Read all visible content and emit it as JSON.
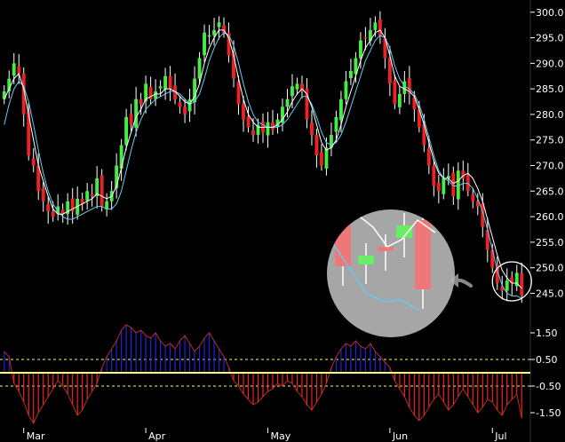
{
  "chart_data": [
    {
      "type": "candlestick",
      "title": "",
      "x_labels": [
        "Mar",
        "Apr",
        "May",
        "Jun",
        "Jul"
      ],
      "y_ticks": [
        "300.0",
        "295.0",
        "290.0",
        "285.0",
        "280.0",
        "275.0",
        "270.0",
        "265.0",
        "260.0",
        "255.0",
        "250.0",
        "245.0"
      ],
      "ylim": [
        243.0,
        301.0
      ],
      "grid": false,
      "colors": {
        "up": "#44ee44",
        "down": "#ee2222",
        "wick": "#ffffff",
        "ma_fast": "#ffffff",
        "ma_slow": "#66ccee"
      },
      "closes": [
        284.5,
        287.0,
        290.0,
        288.0,
        280.0,
        272.0,
        270.0,
        265.0,
        263.0,
        261.0,
        260.0,
        262.0,
        260.5,
        263.0,
        261.0,
        263.5,
        262.5,
        265.0,
        264.0,
        267.5,
        262.0,
        263.0,
        265.0,
        270.0,
        274.0,
        279.5,
        278.0,
        283.0,
        282.0,
        286.0,
        283.0,
        284.5,
        285.5,
        287.5,
        285.0,
        283.0,
        281.5,
        280.0,
        283.0,
        287.0,
        291.0,
        296.0,
        295.5,
        296.5,
        298.0,
        296.0,
        291.5,
        287.0,
        282.0,
        279.0,
        277.5,
        276.0,
        278.0,
        276.5,
        278.5,
        277.0,
        279.0,
        281.5,
        283.0,
        285.5,
        286.0,
        284.5,
        279.0,
        276.0,
        272.0,
        270.0,
        273.5,
        276.0,
        279.5,
        283.0,
        286.5,
        288.5,
        291.0,
        294.5,
        295.0,
        296.5,
        298.0,
        295.5,
        291.0,
        286.0,
        282.0,
        284.0,
        286.5,
        284.0,
        281.0,
        277.5,
        274.0,
        270.0,
        266.0,
        265.0,
        267.5,
        268.0,
        264.0,
        269.0,
        267.5,
        265.0,
        263.0,
        262.0,
        258.0,
        253.5,
        250.0,
        247.0,
        245.5,
        247.5,
        247.0,
        249.0,
        244.5
      ],
      "ma_fast": [
        283.0,
        285.0,
        287.0,
        288.0,
        285.0,
        280.0,
        275.0,
        270.0,
        267.0,
        264.0,
        261.5,
        260.5,
        260.5,
        261.0,
        261.5,
        262.0,
        262.5,
        263.0,
        263.5,
        264.5,
        264.0,
        263.5,
        264.0,
        266.0,
        269.5,
        273.5,
        276.5,
        279.5,
        281.0,
        283.0,
        283.5,
        284.0,
        284.0,
        285.0,
        285.0,
        284.5,
        283.5,
        282.5,
        282.0,
        283.5,
        286.0,
        290.0,
        293.0,
        295.0,
        296.5,
        296.5,
        295.0,
        291.5,
        287.0,
        283.0,
        280.0,
        278.5,
        277.5,
        277.5,
        277.5,
        277.5,
        278.0,
        279.0,
        280.5,
        282.5,
        284.0,
        285.0,
        284.0,
        281.5,
        278.0,
        274.5,
        273.0,
        273.5,
        275.0,
        278.0,
        281.5,
        284.5,
        287.5,
        290.5,
        293.0,
        294.5,
        296.0,
        296.5,
        295.0,
        291.5,
        287.5,
        285.5,
        285.0,
        284.5,
        283.5,
        281.0,
        278.0,
        274.5,
        271.0,
        268.5,
        267.5,
        267.5,
        266.5,
        267.0,
        268.0,
        268.5,
        267.5,
        265.5,
        263.0,
        259.5,
        256.0,
        252.5,
        249.5,
        248.0,
        247.0,
        247.0,
        246.0
      ],
      "ma_slow": [
        278.0,
        282.0,
        285.0,
        286.5,
        285.5,
        282.5,
        278.0,
        273.0,
        268.5,
        265.0,
        262.5,
        261.0,
        260.0,
        259.5,
        259.5,
        260.0,
        260.5,
        261.0,
        261.5,
        262.0,
        262.0,
        261.5,
        261.5,
        262.5,
        265.0,
        269.0,
        273.0,
        276.5,
        279.0,
        281.0,
        282.0,
        283.0,
        283.5,
        284.0,
        284.5,
        284.5,
        284.0,
        283.0,
        282.0,
        282.5,
        284.0,
        287.0,
        290.5,
        293.0,
        295.0,
        296.0,
        295.5,
        293.5,
        290.0,
        286.0,
        282.5,
        280.0,
        278.5,
        278.0,
        277.5,
        277.5,
        277.5,
        278.0,
        279.0,
        280.5,
        282.0,
        283.5,
        283.5,
        282.0,
        279.5,
        276.5,
        274.5,
        274.0,
        274.5,
        276.0,
        278.5,
        281.5,
        284.5,
        287.5,
        290.5,
        292.5,
        294.5,
        295.5,
        295.0,
        293.0,
        289.5,
        287.0,
        285.5,
        285.0,
        284.0,
        282.0,
        279.0,
        275.5,
        272.0,
        269.0,
        267.5,
        267.0,
        266.0,
        266.0,
        266.5,
        266.5,
        265.5,
        263.5,
        261.0,
        257.5,
        253.5,
        249.5,
        246.5,
        245.0,
        244.5,
        244.5,
        244.0
      ],
      "annotation": "circled last candles magnified in inset"
    },
    {
      "type": "bar",
      "title": "",
      "y_ticks": [
        "1.50",
        "0.50",
        "-0.50",
        "-1.50"
      ],
      "ylim": [
        -2.0,
        2.0
      ],
      "reference_lines": [
        0.5,
        -0.5
      ],
      "zero_line_color": "#ffff66",
      "colors": {
        "positive": "#2222dd",
        "negative": "#ee2222"
      },
      "values": [
        0.8,
        0.6,
        -0.4,
        -0.7,
        -1.1,
        -1.6,
        -1.9,
        -1.5,
        -1.2,
        -0.9,
        -0.6,
        -0.3,
        -0.5,
        -0.8,
        -1.2,
        -1.6,
        -1.4,
        -1.0,
        -0.7,
        -0.4,
        0.2,
        0.6,
        0.9,
        1.2,
        1.6,
        1.8,
        1.7,
        1.5,
        1.6,
        1.4,
        1.3,
        1.5,
        1.2,
        1.0,
        1.1,
        0.9,
        1.2,
        1.4,
        1.1,
        0.8,
        1.0,
        1.3,
        1.5,
        1.2,
        0.9,
        0.6,
        0.2,
        -0.3,
        -0.5,
        -0.8,
        -1.0,
        -1.2,
        -1.1,
        -0.9,
        -0.7,
        -0.6,
        -0.4,
        -0.5,
        -0.3,
        -0.4,
        -0.7,
        -0.9,
        -1.2,
        -1.4,
        -1.1,
        -0.8,
        -0.4,
        0.2,
        0.6,
        0.9,
        1.1,
        1.0,
        1.2,
        1.0,
        0.9,
        1.1,
        0.8,
        0.6,
        0.4,
        0.2,
        -0.3,
        -0.6,
        -0.9,
        -1.3,
        -1.6,
        -1.8,
        -1.6,
        -1.3,
        -1.0,
        -0.8,
        -1.1,
        -1.4,
        -1.2,
        -0.9,
        -0.6,
        -0.9,
        -1.2,
        -1.5,
        -1.3,
        -1.0,
        -1.1,
        -1.4,
        -1.6,
        -1.2,
        -1.0,
        -0.8,
        -1.7
      ]
    }
  ]
}
